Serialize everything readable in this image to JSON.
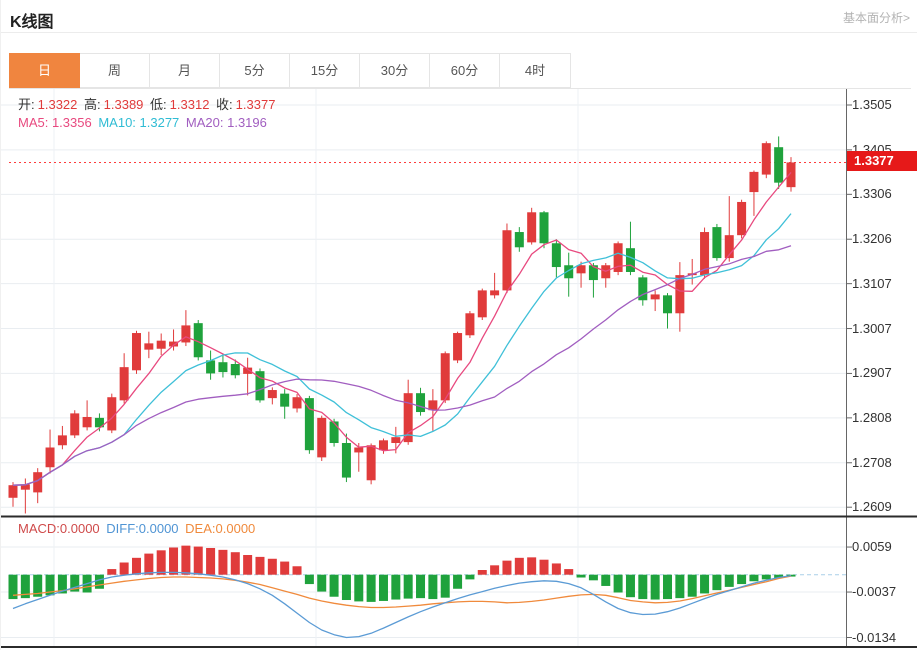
{
  "header": {
    "title": "K线图",
    "link": "基本面分析>"
  },
  "tabs": {
    "active_index": 0,
    "items": [
      "日",
      "周",
      "月",
      "5分",
      "15分",
      "30分",
      "60分",
      "4时"
    ],
    "names": [
      "tab-day",
      "tab-week",
      "tab-month",
      "tab-5min",
      "tab-15min",
      "tab-30min",
      "tab-60min",
      "tab-4hour"
    ]
  },
  "main_chart": {
    "legend": {
      "open_label": "开:",
      "open": "1.3322",
      "high_label": "高:",
      "high": "1.3389",
      "low_label": "低:",
      "low": "1.3312",
      "close_label": "收:",
      "close": "1.3377"
    },
    "ma_legend": {
      "ma5": "MA5: 1.3356",
      "ma10": "MA10: 1.3277",
      "ma20": "MA20: 1.3196"
    },
    "last_price": "1.3377"
  },
  "macd_panel": {
    "legend": {
      "macd": "MACD:0.0000",
      "diff": "DIFF:0.0000",
      "dea": "DEA:0.0000"
    }
  },
  "colors": {
    "up": "#e03b3b",
    "down": "#1fa23c",
    "badge": "#e61919",
    "dotted_price_line": "#ff3b3b",
    "ma5": "#e8497f",
    "ma10": "#3fc0d8",
    "ma20": "#a15ec0",
    "diff": "#5b9bd5",
    "dea": "#f08a3c",
    "zero_dash": "#a9cfe8",
    "grid": "#e9edf1",
    "vgrid": "#eef1f5",
    "axis": "#666666",
    "axis_text": "#333333",
    "separator": "#2b2b2b",
    "active_tab": "#f0853f"
  },
  "chart_data": {
    "type": "candlestick+macd",
    "title": "K线图",
    "ohlc_last": {
      "open": 1.3322,
      "high": 1.3389,
      "low": 1.3312,
      "close": 1.3377
    },
    "ma_last": {
      "ma5": 1.3356,
      "ma10": 1.3277,
      "ma20": 1.3196
    },
    "last_price": 1.3377,
    "y_axis": {
      "labels": [
        1.3505,
        1.3405,
        1.3306,
        1.3206,
        1.3107,
        1.3007,
        1.2907,
        1.2808,
        1.2708,
        1.2609
      ],
      "max": 1.3505,
      "min": 1.2609
    },
    "candles": [
      [
        1.263,
        1.2665,
        1.261,
        1.2658
      ],
      [
        1.2648,
        1.2673,
        1.2595,
        1.266
      ],
      [
        1.2642,
        1.2696,
        1.2618,
        1.2687
      ],
      [
        1.2698,
        1.2782,
        1.2684,
        1.2742
      ],
      [
        1.2747,
        1.279,
        1.2738,
        1.2769
      ],
      [
        1.2769,
        1.2825,
        1.2763,
        1.2818
      ],
      [
        1.2787,
        1.2847,
        1.278,
        1.281
      ],
      [
        1.2808,
        1.2818,
        1.2778,
        1.2787
      ],
      [
        1.278,
        1.2862,
        1.2774,
        1.2854
      ],
      [
        1.2847,
        1.2952,
        1.284,
        1.2921
      ],
      [
        1.2914,
        1.3002,
        1.2906,
        1.2997
      ],
      [
        1.296,
        1.3,
        1.2941,
        1.2974
      ],
      [
        1.2962,
        1.2996,
        1.2948,
        1.298
      ],
      [
        1.2967,
        1.3005,
        1.2958,
        1.2978
      ],
      [
        1.2976,
        1.3048,
        1.2968,
        1.3014
      ],
      [
        1.3019,
        1.3026,
        1.2936,
        1.2943
      ],
      [
        1.2936,
        1.2958,
        1.2893,
        1.2907
      ],
      [
        1.2932,
        1.2948,
        1.2898,
        1.291
      ],
      [
        1.2928,
        1.2938,
        1.2896,
        1.2903
      ],
      [
        1.2906,
        1.2942,
        1.2858,
        1.292
      ],
      [
        1.2912,
        1.2918,
        1.2842,
        1.2847
      ],
      [
        1.2852,
        1.2876,
        1.2838,
        1.287
      ],
      [
        1.2862,
        1.2872,
        1.2806,
        1.2833
      ],
      [
        1.2829,
        1.2861,
        1.282,
        1.2854
      ],
      [
        1.2852,
        1.2857,
        1.2728,
        1.2736
      ],
      [
        1.272,
        1.2813,
        1.2712,
        1.2808
      ],
      [
        1.28,
        1.2806,
        1.2744,
        1.2752
      ],
      [
        1.2752,
        1.2773,
        1.2665,
        1.2675
      ],
      [
        1.2731,
        1.2752,
        1.2688,
        1.2742
      ],
      [
        1.2669,
        1.2751,
        1.266,
        1.2747
      ],
      [
        1.2736,
        1.2762,
        1.2728,
        1.2758
      ],
      [
        1.2752,
        1.2788,
        1.2729,
        1.2765
      ],
      [
        1.2754,
        1.2893,
        1.2748,
        1.2863
      ],
      [
        1.2863,
        1.2875,
        1.2813,
        1.2821
      ],
      [
        1.2825,
        1.2872,
        1.2779,
        1.2847
      ],
      [
        1.2847,
        1.2956,
        1.2841,
        1.2952
      ],
      [
        1.2936,
        1.3,
        1.293,
        1.2997
      ],
      [
        1.2992,
        1.3046,
        1.2986,
        1.3041
      ],
      [
        1.3032,
        1.3096,
        1.3026,
        1.3092
      ],
      [
        1.3081,
        1.3131,
        1.3074,
        1.3092
      ],
      [
        1.3092,
        1.3241,
        1.3086,
        1.3226
      ],
      [
        1.3222,
        1.3233,
        1.3178,
        1.3188
      ],
      [
        1.3199,
        1.3276,
        1.3194,
        1.3266
      ],
      [
        1.3266,
        1.3269,
        1.3186,
        1.3197
      ],
      [
        1.3197,
        1.3206,
        1.3121,
        1.3144
      ],
      [
        1.3148,
        1.3176,
        1.3078,
        1.3119
      ],
      [
        1.313,
        1.3156,
        1.3098,
        1.3148
      ],
      [
        1.3148,
        1.3153,
        1.3076,
        1.3115
      ],
      [
        1.3119,
        1.3153,
        1.3098,
        1.3148
      ],
      [
        1.3133,
        1.3201,
        1.3126,
        1.3197
      ],
      [
        1.3186,
        1.3245,
        1.3126,
        1.3133
      ],
      [
        1.3121,
        1.3126,
        1.3058,
        1.307
      ],
      [
        1.3072,
        1.3092,
        1.3046,
        1.3083
      ],
      [
        1.3081,
        1.3086,
        1.3007,
        1.3041
      ],
      [
        1.3041,
        1.3155,
        1.3,
        1.3126
      ],
      [
        1.3126,
        1.3162,
        1.3105,
        1.313
      ],
      [
        1.3126,
        1.3232,
        1.3118,
        1.3222
      ],
      [
        1.3233,
        1.324,
        1.3158,
        1.3164
      ],
      [
        1.3164,
        1.3302,
        1.3156,
        1.3215
      ],
      [
        1.3215,
        1.3294,
        1.3208,
        1.3289
      ],
      [
        1.3311,
        1.3359,
        1.3258,
        1.3356
      ],
      [
        1.335,
        1.3424,
        1.3342,
        1.342
      ],
      [
        1.3411,
        1.3435,
        1.3318,
        1.3332
      ],
      [
        1.3322,
        1.3389,
        1.3312,
        1.3377
      ]
    ],
    "macd": {
      "last_values": {
        "macd": 0.0,
        "diff": 0.0,
        "dea": 0.0
      },
      "y_axis": {
        "labels": [
          0.0059,
          -0.0037,
          -0.0134
        ]
      },
      "bars": [
        -0.0052,
        -0.005,
        -0.0047,
        -0.0044,
        -0.004,
        -0.0036,
        -0.0038,
        -0.003,
        0.0012,
        0.0026,
        0.0036,
        0.0045,
        0.0052,
        0.0058,
        0.0062,
        0.006,
        0.0057,
        0.0053,
        0.0048,
        0.0042,
        0.0038,
        0.0034,
        0.0028,
        0.0018,
        -0.002,
        -0.0036,
        -0.0047,
        -0.0054,
        -0.0057,
        -0.0058,
        -0.0056,
        -0.0053,
        -0.0051,
        -0.005,
        -0.0052,
        -0.0049,
        -0.003,
        -0.001,
        0.001,
        0.002,
        0.003,
        0.0036,
        0.0037,
        0.0032,
        0.0024,
        0.0012,
        -0.0006,
        -0.0012,
        -0.0024,
        -0.0038,
        -0.0048,
        -0.0052,
        -0.0053,
        -0.0052,
        -0.005,
        -0.0047,
        -0.004,
        -0.0033,
        -0.0026,
        -0.002,
        -0.0014,
        -0.001,
        -0.0007,
        -0.0004
      ],
      "diff": [
        -0.0072,
        -0.0062,
        -0.0053,
        -0.0044,
        -0.0035,
        -0.0027,
        -0.0019,
        -0.0011,
        -0.0005,
        -0.0001,
        0.0002,
        0.0004,
        0.0005,
        0.0005,
        0.0004,
        0.0002,
        -0.0001,
        -0.0005,
        -0.0011,
        -0.0019,
        -0.003,
        -0.0044,
        -0.0062,
        -0.0082,
        -0.0102,
        -0.0118,
        -0.0128,
        -0.0134,
        -0.0132,
        -0.0125,
        -0.0114,
        -0.0102,
        -0.009,
        -0.0079,
        -0.0069,
        -0.006,
        -0.0051,
        -0.0043,
        -0.0036,
        -0.0029,
        -0.0023,
        -0.0018,
        -0.0015,
        -0.0013,
        -0.0014,
        -0.0019,
        -0.0028,
        -0.0042,
        -0.0058,
        -0.0072,
        -0.0081,
        -0.0085,
        -0.0084,
        -0.0079,
        -0.0071,
        -0.0061,
        -0.0051,
        -0.0042,
        -0.0034,
        -0.0026,
        -0.0018,
        -0.0012,
        -0.0006,
        -0.0002
      ],
      "dea": [
        -0.0044,
        -0.0042,
        -0.004,
        -0.0037,
        -0.0034,
        -0.003,
        -0.0026,
        -0.0022,
        -0.0018,
        -0.0014,
        -0.0011,
        -0.0008,
        -0.0006,
        -0.0005,
        -0.0005,
        -0.0006,
        -0.0007,
        -0.0009,
        -0.0012,
        -0.0016,
        -0.0021,
        -0.0028,
        -0.0035,
        -0.0042,
        -0.005,
        -0.0056,
        -0.0061,
        -0.0065,
        -0.0068,
        -0.007,
        -0.007,
        -0.0069,
        -0.0067,
        -0.0065,
        -0.0062,
        -0.006,
        -0.0058,
        -0.0057,
        -0.0057,
        -0.0058,
        -0.006,
        -0.0059,
        -0.0057,
        -0.0054,
        -0.005,
        -0.0046,
        -0.0043,
        -0.0042,
        -0.0044,
        -0.0049,
        -0.0055,
        -0.0058,
        -0.006,
        -0.0059,
        -0.0056,
        -0.0051,
        -0.0045,
        -0.0039,
        -0.0033,
        -0.0027,
        -0.0021,
        -0.0015,
        -0.0008,
        -0.0003
      ]
    }
  }
}
